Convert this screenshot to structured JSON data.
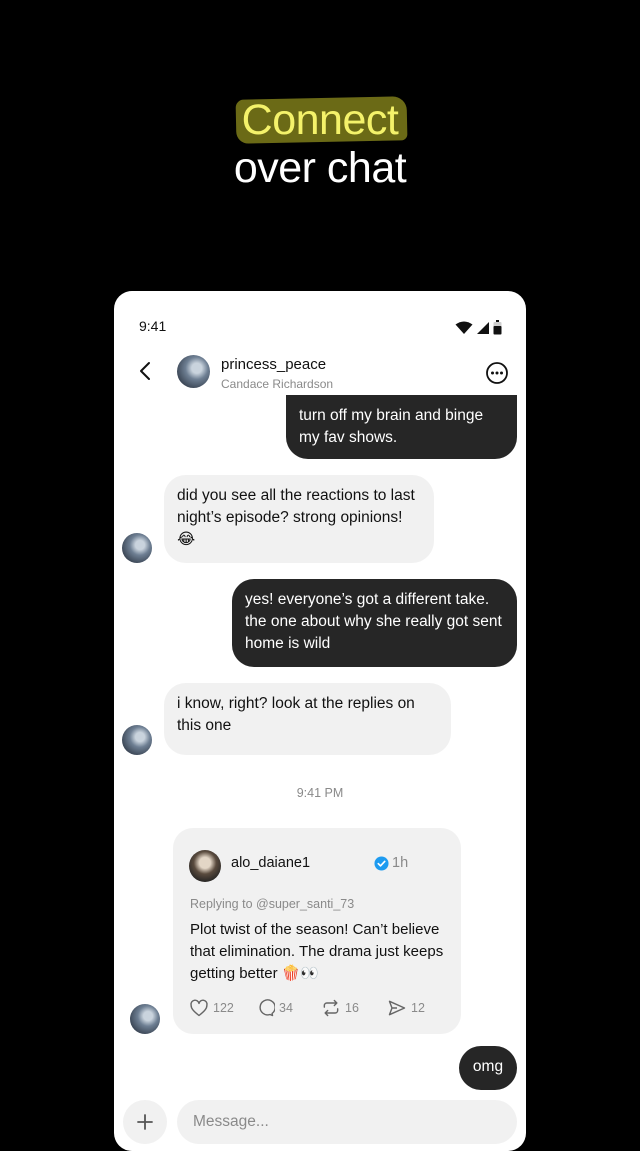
{
  "hero": {
    "highlight": "Connect",
    "line2": "over chat"
  },
  "status_bar": {
    "time": "9:41"
  },
  "header": {
    "username": "princess_peace",
    "subtitle": "Candace Richardson"
  },
  "messages": [
    {
      "from": "me",
      "text": "turn off my brain and binge my fav shows."
    },
    {
      "from": "them",
      "text": "did you see all the reactions to last night’s episode? strong opinions! 😂"
    },
    {
      "from": "me",
      "text": "yes! everyone’s got a different take. the one about why she really got sent home is wild"
    },
    {
      "from": "them",
      "text": "i know, right? look at the replies on this one"
    },
    {
      "from": "me",
      "text": "omg"
    }
  ],
  "timestamp": "9:41 PM",
  "shared_post": {
    "username": "alo_daiane1",
    "age": "1h",
    "replying_to": "Replying to @super_santi_73",
    "text": "Plot twist of the season! Can’t believe that elimination. The drama just keeps getting better 🍿👀",
    "likes": "122",
    "replies": "34",
    "reposts": "16",
    "shares": "12"
  },
  "composer": {
    "placeholder": "Message..."
  },
  "colors": {
    "highlight_text": "#f4f26a",
    "highlight_mark": "#6b6a16",
    "outgoing_bubble": "#262626",
    "incoming_bubble": "#f1f1f1",
    "verified": "#1d9bf0"
  },
  "icons": [
    "wifi-icon",
    "signal-icon",
    "battery-icon",
    "back-arrow-icon",
    "more-options-icon",
    "verified-icon",
    "heart-icon",
    "comment-icon",
    "repost-icon",
    "share-icon",
    "plus-icon"
  ]
}
